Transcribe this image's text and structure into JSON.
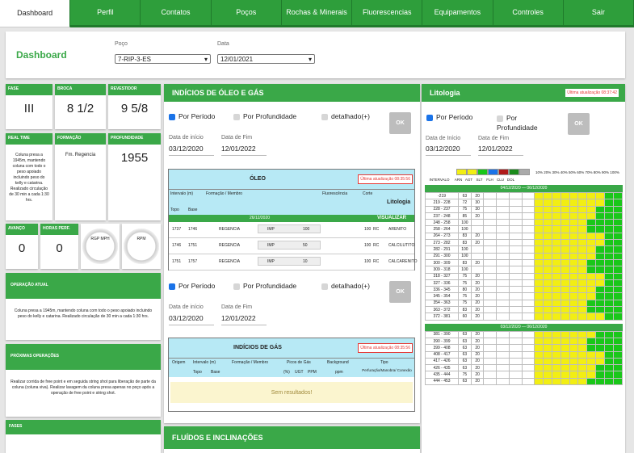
{
  "nav": [
    "Dashboard",
    "Perfil",
    "Contatos",
    "Poços",
    "Rochas & Minerais",
    "Fluorescencias",
    "Equipamentos",
    "Controles",
    "Sair"
  ],
  "top": {
    "title": "Dashboard",
    "poco_label": "Poço",
    "poco_value": "7-RIP-3-ES",
    "data_label": "Data",
    "data_value": "12/01/2021"
  },
  "cards": {
    "fase": {
      "label": "FASE",
      "value": "III"
    },
    "broca": {
      "label": "BROCA",
      "value": "8 1/2"
    },
    "revestidor": {
      "label": "REVESTIDOR",
      "value": "9 5/8"
    },
    "realtime": {
      "label": "REAL TIME",
      "value": "Coluna presa a 1945m, mantendo coluna com todo o peso apoiado incluindo peso do kelly e catarina. Realizado circulação de 30 min a cada 1:30 hrs."
    },
    "formacao": {
      "label": "FORMAÇÃO",
      "value": "Fm. Regencia"
    },
    "profundidade": {
      "label": "PROFUNDIDADE",
      "value": "1955"
    },
    "avanco": {
      "label": "AVANÇO",
      "value": "0"
    },
    "horasperf": {
      "label": "HORAS PERF.",
      "value": "0"
    },
    "operacao": {
      "label": "OPERAÇÃO ATUAL",
      "value": "Coluna presa a 1945m, mantendo coluna com todo o peso apoiado incluindo peso do kelly e catarina. Realizado circulação de 30 min a cada 1:30 hrs."
    },
    "proximas": {
      "label": "PRÓXIMAS OPERAÇÕES",
      "value": "Realizar corrida de free point e em seguida string shot para liberação de parte da coluna (coluna viva). Realizar lavagem da coluna presa apenas no poço após a operação de free point e string shot."
    },
    "fases": {
      "label": "FASES"
    }
  },
  "gauges": [
    "RGP MPH",
    "RPM"
  ],
  "indicios": {
    "title": "INDÍCIOS DE ÓLEO E GÁS",
    "opt_periodo": "Por Período",
    "opt_prof": "Por Profundidade",
    "opt_det": "detalhado(+)",
    "ok": "OK",
    "di_label": "Data de início",
    "df_label": "Data de Fim",
    "di": "03/12/2020",
    "df": "12/01/2022",
    "oleo_title": "ÓLEO",
    "oleo_update": "Última atualização 08:35:56",
    "oleo_cols": [
      "Intervalo (m)",
      "Formação / Membro",
      "Fluorescência",
      "Corte",
      "Litologia"
    ],
    "oleo_sub": [
      "Topo",
      "Base"
    ],
    "oleo_date": "26/12/2020",
    "visualizar": "VISUALIZAR",
    "oleo_rows": [
      {
        "topo": "1737",
        "base": "1746",
        "form": "REGENCIA",
        "imp": "IMP",
        "val": "100",
        "corte": "100",
        "rc": "RC",
        "lito": "ARENITO"
      },
      {
        "topo": "1746",
        "base": "1751",
        "form": "REGENCIA",
        "imp": "IMP",
        "val": "50",
        "corte": "100",
        "rc": "RC",
        "lito": "CALCILUTITO"
      },
      {
        "topo": "1751",
        "base": "1757",
        "form": "REGENCIA",
        "imp": "IMP",
        "val": "10",
        "corte": "100",
        "rc": "RC",
        "lito": "CALCARENITO"
      }
    ],
    "gas_title": "INDÍCIOS DE GÁS",
    "gas_update": "Última atualização 08:35:56",
    "gas_cols": [
      "Origem",
      "Intervalo (m)",
      "Formação / Membro",
      "Picos de Gás",
      "Background",
      "Tipo"
    ],
    "gas_sub": [
      "Topo",
      "Base",
      "(%)",
      "UGT",
      "PPM",
      "ppm",
      "Perfuração/Manobra/ Conexão"
    ],
    "gas_empty": "Sem resultados!",
    "fluidos_title": "FLUÍDOS E INCLINAÇÕES"
  },
  "lito": {
    "title": "Litologia",
    "update": "Última atualização 08:37:42",
    "opt_periodo": "Por Período",
    "opt_prof": "Por Profundidade",
    "ok": "OK",
    "di_label": "Data de Início",
    "df_label": "Data de Fim",
    "di": "03/12/2020",
    "df": "12/01/2022",
    "cols": [
      "INTERVALO",
      "ARN",
      "AGT",
      "SLT",
      "FLH",
      "CLU",
      "DOL"
    ],
    "scale": "10% 20% 30% 40% 50% 60% 70% 80% 90% 100%",
    "legend_colors": [
      "#f2ee13",
      "#f2ee13",
      "#19c719",
      "#1a73e8",
      "#b01a1a",
      "#1a8a1a",
      "#aaaaaa"
    ],
    "group1": "04/12/2020 — 06/12/2020",
    "group2": "03/12/2020 — 06/12/2020",
    "rows1": [
      {
        "i": "-219",
        "a": "63",
        "b": "20"
      },
      {
        "i": "219 - 228",
        "a": "72",
        "b": "30"
      },
      {
        "i": "228 - 237",
        "a": "75",
        "b": "30"
      },
      {
        "i": "237 - 248",
        "a": "85",
        "b": "20"
      },
      {
        "i": "248 - 258",
        "a": "100",
        "b": ""
      },
      {
        "i": "258 - 264",
        "a": "100",
        "b": ""
      },
      {
        "i": "264 - 273",
        "a": "83",
        "b": "20"
      },
      {
        "i": "273 - 282",
        "a": "83",
        "b": "20"
      },
      {
        "i": "282 - 291",
        "a": "100",
        "b": ""
      },
      {
        "i": "291 - 300",
        "a": "100",
        "b": ""
      },
      {
        "i": "300 - 309",
        "a": "83",
        "b": "20"
      },
      {
        "i": "309 - 318",
        "a": "100",
        "b": ""
      },
      {
        "i": "318 - 327",
        "a": "75",
        "b": "20"
      },
      {
        "i": "327 - 336",
        "a": "75",
        "b": "20"
      },
      {
        "i": "336 - 345",
        "a": "80",
        "b": "20"
      },
      {
        "i": "345 - 354",
        "a": "75",
        "b": "20"
      },
      {
        "i": "354 - 363",
        "a": "75",
        "b": "20"
      },
      {
        "i": "363 - 372",
        "a": "83",
        "b": "20"
      },
      {
        "i": "372 - 381",
        "a": "60",
        "b": "20"
      }
    ],
    "rows2": [
      {
        "i": "381 - 390",
        "a": "63",
        "b": "20"
      },
      {
        "i": "390 - 399",
        "a": "63",
        "b": "20"
      },
      {
        "i": "399 - 408",
        "a": "63",
        "b": "20"
      },
      {
        "i": "408 - 417",
        "a": "63",
        "b": "20"
      },
      {
        "i": "417 - 426",
        "a": "63",
        "b": "20"
      },
      {
        "i": "426 - 435",
        "a": "63",
        "b": "20"
      },
      {
        "i": "435 - 444",
        "a": "75",
        "b": "20"
      },
      {
        "i": "444 - 453",
        "a": "63",
        "b": "20"
      }
    ]
  }
}
